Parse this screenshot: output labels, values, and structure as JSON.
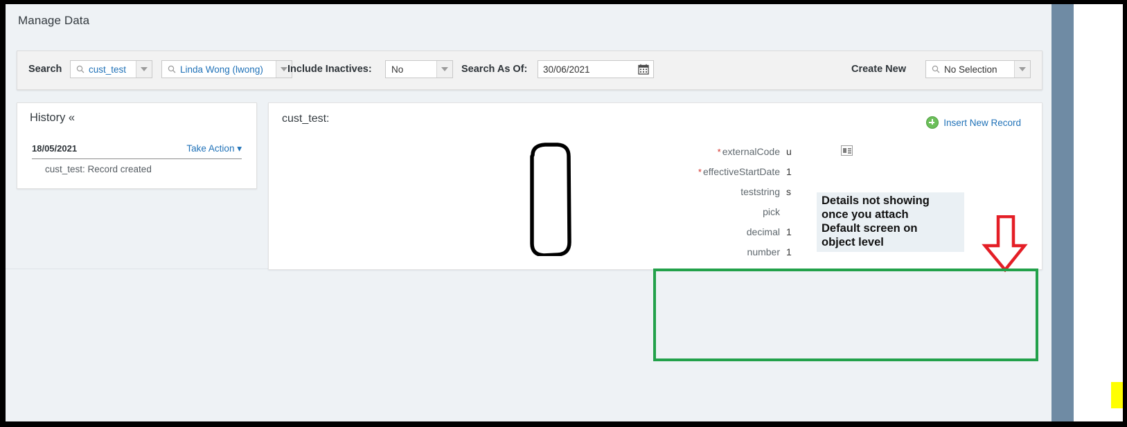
{
  "page": {
    "title": "Manage Data"
  },
  "toolbar": {
    "search_label": "Search",
    "search_entity": {
      "value": "cust_test",
      "icon": "search-icon",
      "caret": "chevron-down-icon"
    },
    "search_user": {
      "value": "Linda Wong (lwong)",
      "icon": "search-icon",
      "caret": "chevron-down-icon"
    },
    "include_inactives_label": "Include Inactives:",
    "include_inactives": {
      "value": "No",
      "caret": "chevron-down-icon"
    },
    "search_as_of_label": "Search As Of:",
    "search_as_of": {
      "value": "30/06/2021",
      "icon": "calendar-icon"
    },
    "create_new_label": "Create New",
    "create_new": {
      "value": "No Selection",
      "icon": "search-icon",
      "caret": "chevron-down-icon"
    }
  },
  "history": {
    "title": "History «",
    "collapse_icon": "double-chevron-left-icon",
    "rows": [
      {
        "date": "18/05/2021",
        "action_label": "Take Action",
        "action_caret": "caret-down-icon",
        "entry": "cust_test: Record created"
      }
    ]
  },
  "record": {
    "heading": "cust_test:",
    "insert_new_record": {
      "label": "Insert New Record",
      "icon": "plus-circle-icon"
    },
    "detail_icon": "detail-card-icon",
    "fields": [
      {
        "label": "externalCode",
        "required": true,
        "value": "u"
      },
      {
        "label": "effectiveStartDate",
        "required": true,
        "value": "1"
      },
      {
        "label": "teststring",
        "required": false,
        "value": "s"
      },
      {
        "label": "pick",
        "required": false,
        "value": ""
      },
      {
        "label": "decimal",
        "required": false,
        "value": "1"
      },
      {
        "label": "number",
        "required": false,
        "value": "1"
      }
    ]
  },
  "annotations": {
    "note_text": "Details not showing\nonce  you attach\nDefault screen on\nobject level",
    "note_bg": "#eaf0f4",
    "redaction_color": "#000000",
    "arrow_color": "#e41e26",
    "highlight_color": "#22a14a",
    "marker_color": "#ffff00"
  }
}
